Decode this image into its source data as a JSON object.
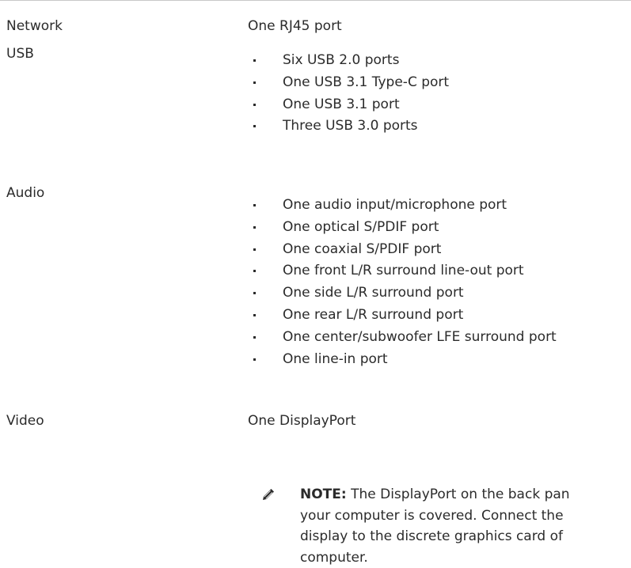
{
  "rows": [
    {
      "label": "Network",
      "value": "One RJ45 port"
    },
    {
      "label": "USB",
      "items": [
        "Six USB 2.0 ports",
        "One USB 3.1 Type-C port",
        "One USB 3.1 port",
        "Three USB 3.0 ports"
      ]
    },
    {
      "label": "Audio",
      "items": [
        "One audio input/microphone port",
        "One optical S/PDIF port",
        "One coaxial S/PDIF port",
        "One front L/R surround line-out port",
        "One side L/R surround port",
        "One rear L/R surround port",
        "One center/subwoofer LFE surround port",
        "One line-in port"
      ]
    },
    {
      "label": "Video",
      "value": "One DisplayPort"
    }
  ],
  "note": {
    "icon": "pencil-icon",
    "prefix": "NOTE:",
    "lines": [
      " The DisplayPort on the back pan",
      "your computer is covered. Connect the",
      "display to the discrete graphics card of",
      "computer."
    ]
  }
}
